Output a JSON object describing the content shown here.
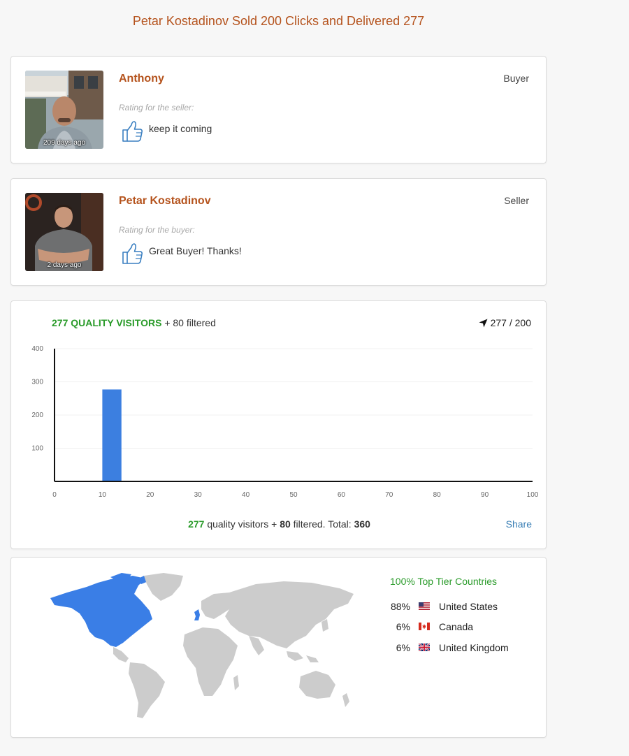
{
  "page": {
    "title": "Petar Kostadinov Sold 200 Clicks and Delivered 277"
  },
  "reviews": [
    {
      "name": "Anthony",
      "role": "Buyer",
      "rating_label": "Rating for the seller:",
      "comment": "keep it coming",
      "time_ago": "209 days ago",
      "rating_icon": "thumbs-up-icon"
    },
    {
      "name": "Petar Kostadinov",
      "role": "Seller",
      "rating_label": "Rating for the buyer:",
      "comment": "Great Buyer! Thanks!",
      "time_ago": "2 days ago",
      "rating_icon": "thumbs-up-icon"
    }
  ],
  "stats": {
    "quality_visitors_heading": "277 QUALITY VISITORS",
    "filtered_heading": "+ 80 filtered",
    "counter_icon": "location-arrow-icon",
    "counter": "277 / 200",
    "footer": {
      "quality": "277",
      "quality_text": "quality visitors + ",
      "filtered": "80",
      "filtered_text": "filtered. Total:",
      "total": "360"
    },
    "share_label": "Share"
  },
  "chart_data": {
    "type": "bar",
    "x": [
      12
    ],
    "values": [
      277
    ],
    "xlim": [
      0,
      100
    ],
    "ylim": [
      0,
      400
    ],
    "xticks": [
      0,
      10,
      20,
      30,
      40,
      50,
      60,
      70,
      80,
      90,
      100
    ],
    "yticks": [
      100,
      200,
      300,
      400
    ],
    "bar_color": "#3c7fe0",
    "grid": true,
    "legend": "none"
  },
  "geo": {
    "tier_title": "100% Top Tier Countries",
    "highlight_color": "#3a7ee6",
    "map_base_color": "#cccccc",
    "countries": [
      {
        "pct": "88%",
        "name": "United States",
        "flag": "us-flag-icon"
      },
      {
        "pct": "6%",
        "name": "Canada",
        "flag": "canada-flag-icon"
      },
      {
        "pct": "6%",
        "name": "United Kingdom",
        "flag": "uk-flag-icon"
      }
    ]
  }
}
